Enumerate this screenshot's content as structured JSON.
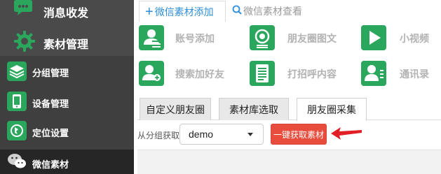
{
  "sidebar": {
    "big_items": [
      {
        "label": "消息收发",
        "icon": "chat-icon"
      },
      {
        "label": "素材管理",
        "icon": "gear-icon"
      }
    ],
    "small_items": [
      {
        "label": "分组管理",
        "icon": "layers-icon"
      },
      {
        "label": "设备管理",
        "icon": "phone-icon"
      },
      {
        "label": "定位设置",
        "icon": "location-icon"
      },
      {
        "label": "微信素材",
        "icon": "wechat-icon"
      }
    ]
  },
  "topnav": {
    "add_tab": "微信素材添加",
    "view_tab": "微信素材查看"
  },
  "features": [
    {
      "label": "账号添加",
      "icon": "account-icon"
    },
    {
      "label": "朋友圈图文",
      "icon": "camera-icon"
    },
    {
      "label": "小视频",
      "icon": "play-icon"
    },
    {
      "label": "搜索加好友",
      "icon": "add-friend-icon"
    },
    {
      "label": "打招呼内容",
      "icon": "document-icon"
    },
    {
      "label": "通讯录",
      "icon": "contacts-icon"
    }
  ],
  "subtabs": [
    {
      "label": "自定义朋友圈"
    },
    {
      "label": "素材库选取"
    },
    {
      "label": "朋友圈采集"
    }
  ],
  "fetch": {
    "group_label": "从分组获取",
    "selected": "demo",
    "button": "一键获取素材"
  },
  "colors": {
    "accent_green": "#2aa65d",
    "accent_blue": "#2e8ed8",
    "button_red": "#e74c3c",
    "sidebar_bg": "#3f3f3f"
  }
}
